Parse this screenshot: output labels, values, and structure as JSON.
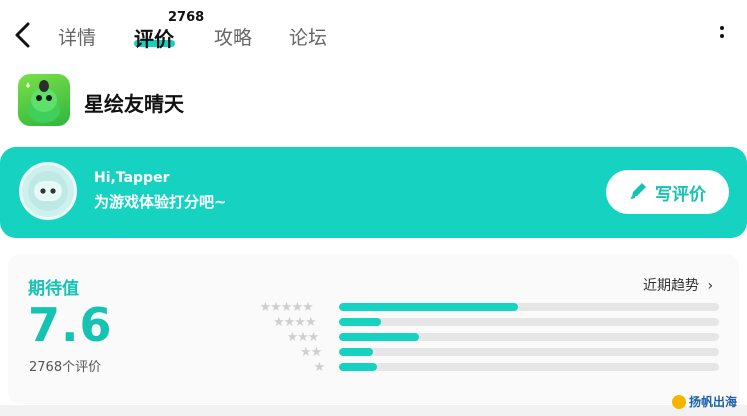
{
  "header": {
    "tabs": [
      {
        "label": "详情"
      },
      {
        "label": "评价",
        "active": true,
        "badge": "2768"
      },
      {
        "label": "攻略"
      },
      {
        "label": "论坛"
      }
    ]
  },
  "app": {
    "name": "星绘友晴天"
  },
  "banner": {
    "greeting": "Hi,Tapper",
    "prompt": "为游戏体验打分吧~",
    "write_label": "写评价"
  },
  "rating": {
    "label": "期待值",
    "score": "7.6",
    "count_text": "2768个评价",
    "trend_label": "近期趋势",
    "distribution": [
      {
        "stars": "★★★★★",
        "fraction": 0.47
      },
      {
        "stars": "★★★★",
        "fraction": 0.11
      },
      {
        "stars": "★★★",
        "fraction": 0.21
      },
      {
        "stars": "★★",
        "fraction": 0.09
      },
      {
        "stars": "★",
        "fraction": 0.1
      }
    ]
  },
  "watermark": {
    "text": "扬帆出海"
  },
  "colors": {
    "accent": "#15d2c1",
    "accent_text": "#15c3b3"
  }
}
